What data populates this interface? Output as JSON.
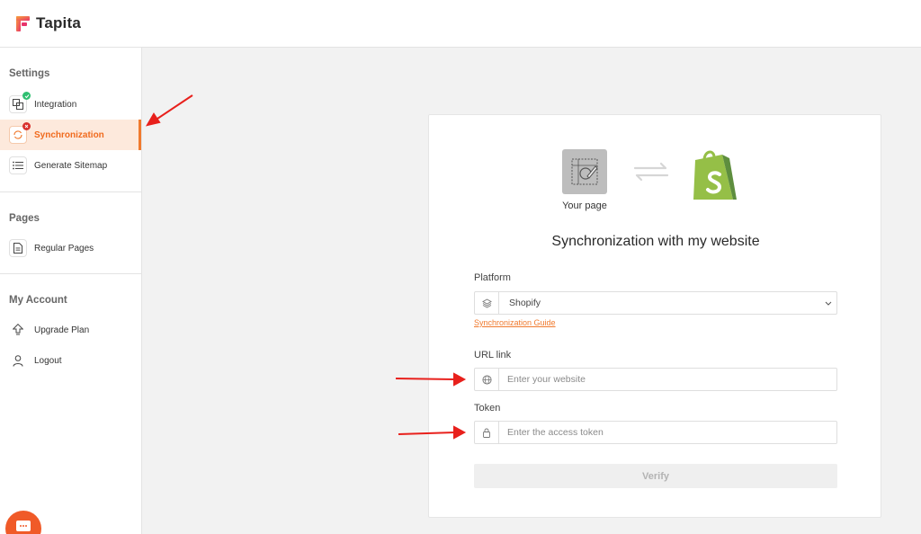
{
  "header": {
    "brand": "Tapita"
  },
  "sidebar": {
    "sections": [
      {
        "title": "Settings"
      },
      {
        "title": "Pages"
      },
      {
        "title": "My Account"
      }
    ],
    "items": [
      {
        "label": "Integration",
        "icon": "integration-icon",
        "status": "connected"
      },
      {
        "label": "Synchronization",
        "icon": "sync-icon",
        "status": "error",
        "active": true
      },
      {
        "label": "Generate Sitemap",
        "icon": "list-icon"
      },
      {
        "label": "Regular Pages",
        "icon": "document-icon"
      },
      {
        "label": "Upgrade Plan",
        "icon": "upgrade-arrow-icon"
      },
      {
        "label": "Logout",
        "icon": "user-icon"
      }
    ]
  },
  "card": {
    "hero_label": "Your page",
    "title": "Synchronization with my website",
    "platform": {
      "label": "Platform",
      "value": "Shopify"
    },
    "guide_link": "Synchronization Guide",
    "url": {
      "label": "URL link",
      "placeholder": "Enter your website"
    },
    "token": {
      "label": "Token",
      "placeholder": "Enter the access token"
    },
    "verify_label": "Verify"
  },
  "colors": {
    "accent": "#f07a2e",
    "active_bg": "#fde9dc",
    "annotation": "#e8201c",
    "shopify_green": "#95bf47",
    "badge_ok": "#2fbf71",
    "badge_error": "#d9302c"
  }
}
